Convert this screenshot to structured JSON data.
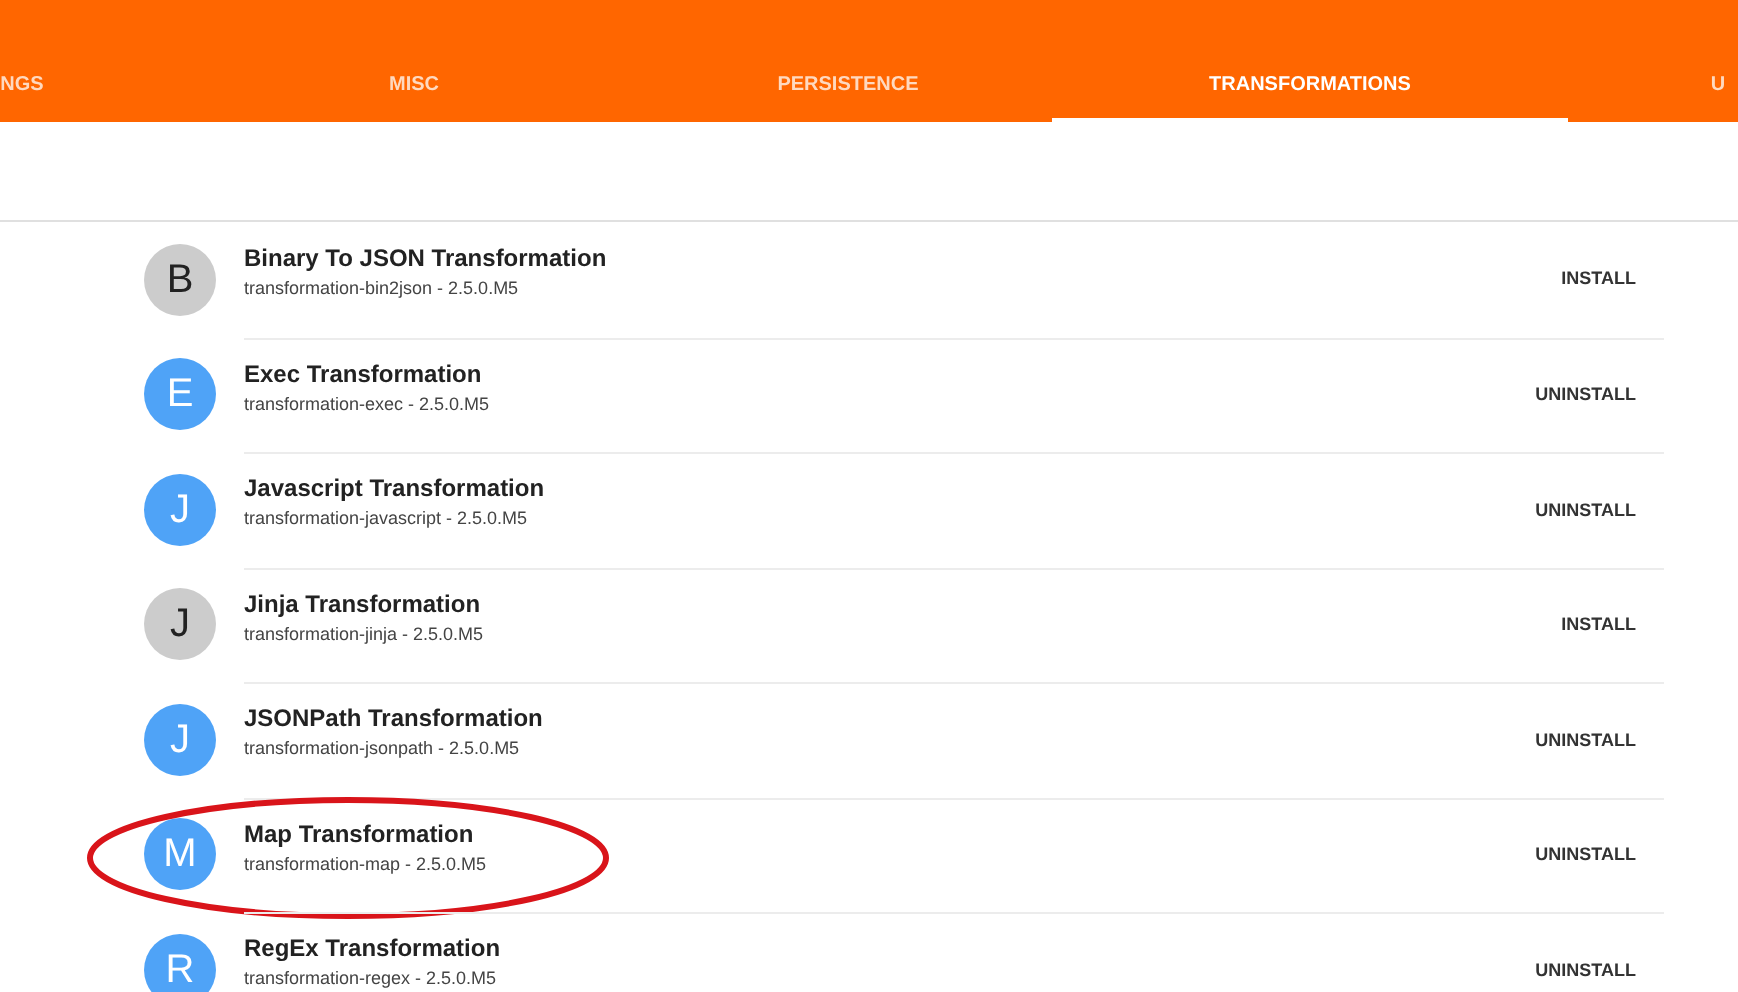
{
  "tabs": [
    {
      "label": "NGS",
      "selected": false
    },
    {
      "label": "MISC",
      "selected": false
    },
    {
      "label": "PERSISTENCE",
      "selected": false
    },
    {
      "label": "TRANSFORMATIONS",
      "selected": true
    },
    {
      "label": "U",
      "selected": false
    }
  ],
  "addons": [
    {
      "letter": "B",
      "name": "Binary To JSON Transformation",
      "version": "transformation-bin2json - 2.5.0.M5",
      "installed": false,
      "action": "INSTALL",
      "circled": false
    },
    {
      "letter": "E",
      "name": "Exec Transformation",
      "version": "transformation-exec - 2.5.0.M5",
      "installed": true,
      "action": "UNINSTALL",
      "circled": false
    },
    {
      "letter": "J",
      "name": "Javascript Transformation",
      "version": "transformation-javascript - 2.5.0.M5",
      "installed": true,
      "action": "UNINSTALL",
      "circled": false
    },
    {
      "letter": "J",
      "name": "Jinja Transformation",
      "version": "transformation-jinja - 2.5.0.M5",
      "installed": false,
      "action": "INSTALL",
      "circled": false
    },
    {
      "letter": "J",
      "name": "JSONPath Transformation",
      "version": "transformation-jsonpath - 2.5.0.M5",
      "installed": true,
      "action": "UNINSTALL",
      "circled": false
    },
    {
      "letter": "M",
      "name": "Map Transformation",
      "version": "transformation-map - 2.5.0.M5",
      "installed": true,
      "action": "UNINSTALL",
      "circled": true
    },
    {
      "letter": "R",
      "name": "RegEx Transformation",
      "version": "transformation-regex - 2.5.0.M5",
      "installed": true,
      "action": "UNINSTALL",
      "circled": false
    }
  ]
}
